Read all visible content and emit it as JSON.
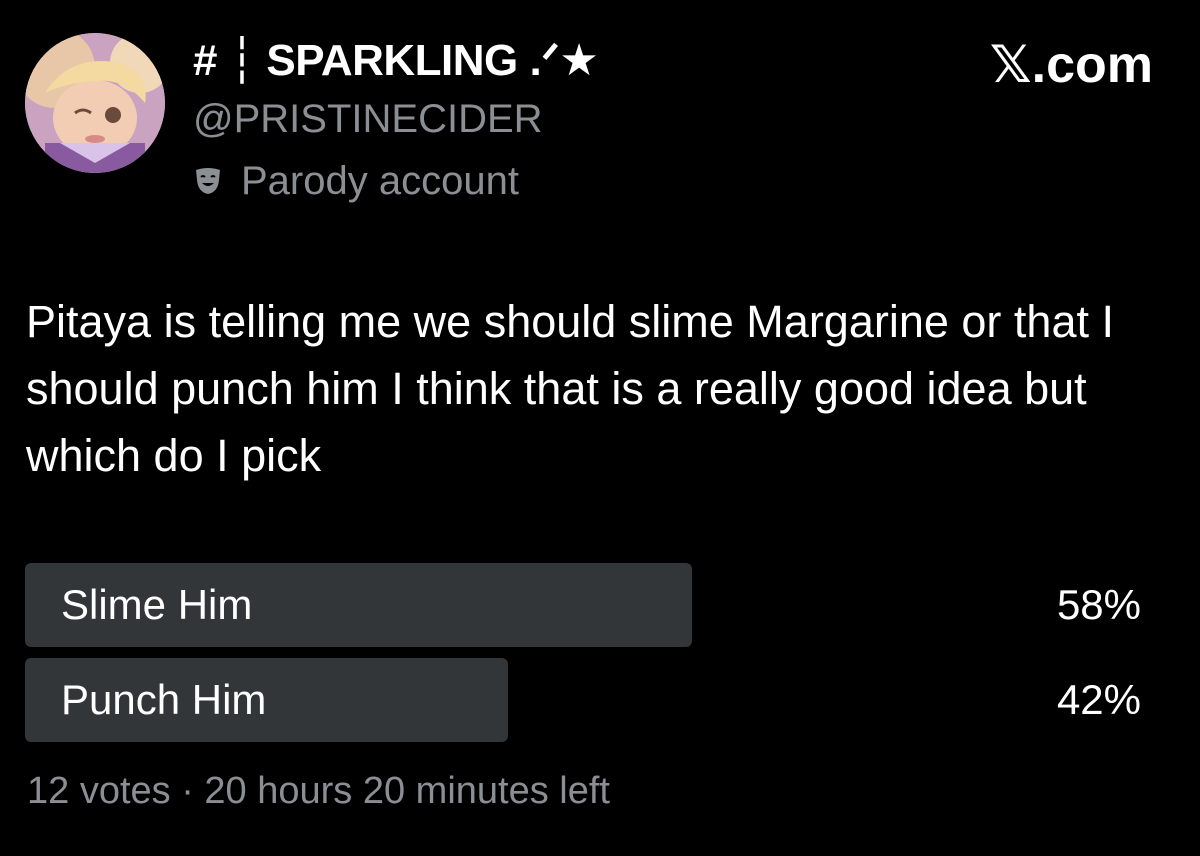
{
  "account": {
    "display_name": "# ┆ SPARKLING .ᐟ★",
    "handle": "@PRISTINECIDER",
    "label": "Parody account",
    "label_icon": "parody-mask-icon"
  },
  "brand": "𝕏.com",
  "post": {
    "text": "Pitaya is telling me we should slime Margarine or that I should punch him I think that is a really good idea but which do I pick"
  },
  "poll": {
    "options": [
      {
        "label": "Slime Him",
        "percent_label": "58%",
        "percent": 58
      },
      {
        "label": "Punch Him",
        "percent_label": "42%",
        "percent": 42
      }
    ],
    "meta": "12 votes · 20 hours 20 minutes left"
  },
  "colors": {
    "background": "#000000",
    "text_primary": "#ffffff",
    "text_secondary": "#8b8f94",
    "poll_bar": "#333639"
  }
}
